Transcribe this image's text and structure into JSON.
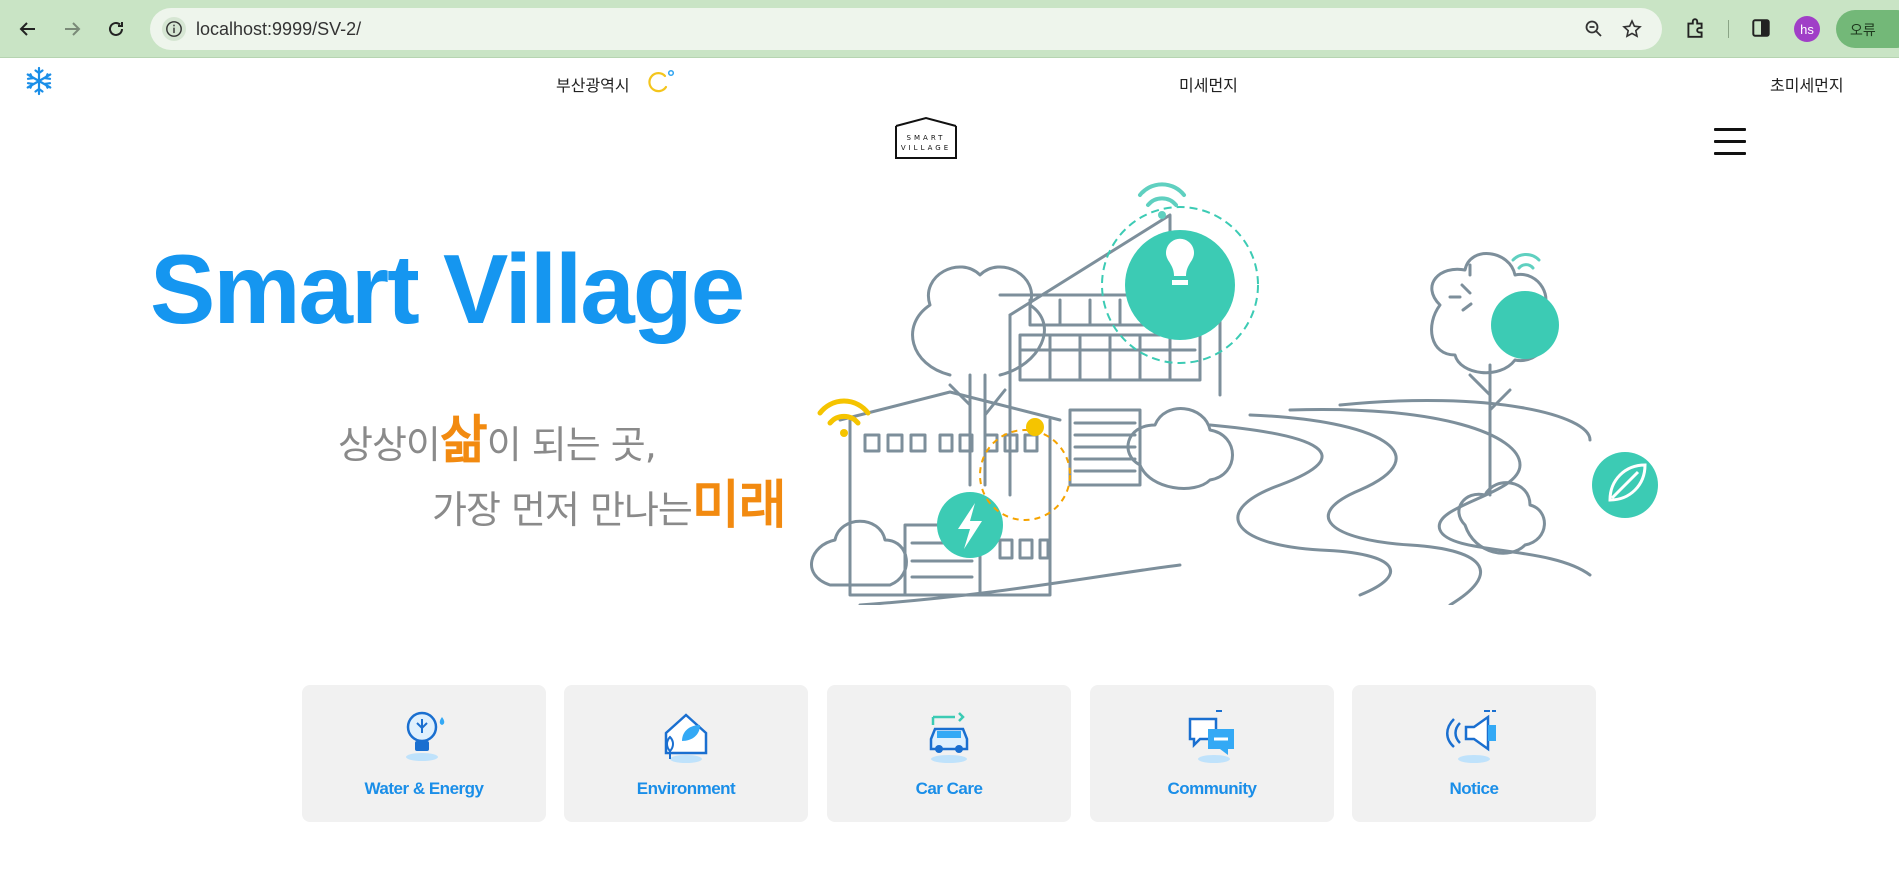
{
  "browser": {
    "url": "localhost:9999/SV-2/",
    "profile_initials": "hs",
    "error_label": "오류"
  },
  "weather": {
    "city": "부산광역시",
    "fine_dust_label": "미세먼지",
    "ultrafine_dust_label": "초미세먼지"
  },
  "hero": {
    "title": "Smart Village",
    "tagline_line1_pre": "상상이",
    "tagline_line1_accent": "삶",
    "tagline_line1_post": "이 되는 곳,",
    "tagline_line2_pre": "가장 먼저 만나는",
    "tagline_line2_accent": "미래"
  },
  "logo": {
    "line1": "SMART",
    "line2": "VILLAGE"
  },
  "services": [
    {
      "label": "Water & Energy",
      "icon": "bulb-icon"
    },
    {
      "label": "Environment",
      "icon": "eco-house-icon"
    },
    {
      "label": "Car Care",
      "icon": "car-icon"
    },
    {
      "label": "Community",
      "icon": "chat-icon"
    },
    {
      "label": "Notice",
      "icon": "megaphone-icon"
    }
  ],
  "colors": {
    "brand_blue": "#1596f0",
    "accent_orange": "#f28a10",
    "teal": "#3ccbb4",
    "browser_green": "#c9e4c5"
  }
}
